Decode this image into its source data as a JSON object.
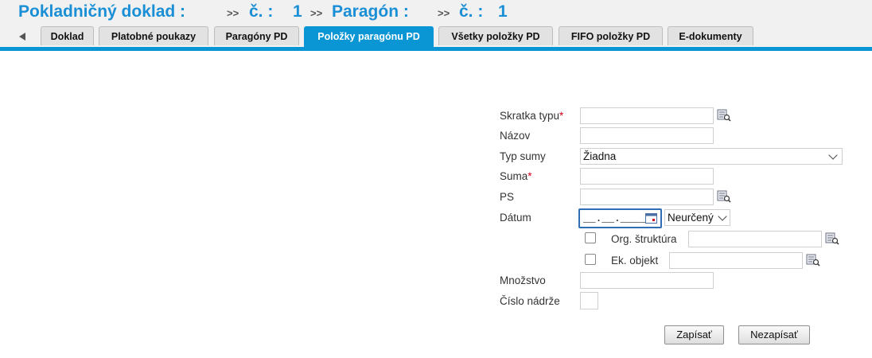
{
  "header": {
    "doc_title": "Pokladničný doklad :",
    "sep1": ">>",
    "no_label1": "č. :",
    "no_value1": "1",
    "sep2": ">>",
    "receipt_title": "Paragón :",
    "sep3": ">>",
    "no_label2": "č. :",
    "no_value2": "1"
  },
  "tabs": [
    {
      "label": "Doklad",
      "active": false
    },
    {
      "label": "Platobné poukazy",
      "active": false
    },
    {
      "label": "Paragóny PD",
      "active": false
    },
    {
      "label": "Položky paragónu PD",
      "active": true
    },
    {
      "label": "Všetky položky PD",
      "active": false
    },
    {
      "label": "FIFO položky PD",
      "active": false
    },
    {
      "label": "E-dokumenty",
      "active": false
    }
  ],
  "form": {
    "skratka_typu": {
      "label": "Skratka typu",
      "required_mark": "*",
      "value": ""
    },
    "nazov": {
      "label": "Názov",
      "value": ""
    },
    "typ_sumy": {
      "label": "Typ sumy",
      "value": "Žiadna"
    },
    "suma": {
      "label": "Suma",
      "required_mark": "*",
      "value": ""
    },
    "ps": {
      "label": "PS",
      "value": ""
    },
    "datum": {
      "label": "Dátum",
      "placeholder": "__.__.____",
      "mode_value": "Neurčený"
    },
    "org_struktura": {
      "label": "Org. štruktúra",
      "checked": false,
      "value": ""
    },
    "ek_objekt": {
      "label": "Ek. objekt",
      "checked": false,
      "value": ""
    },
    "mnozstvo": {
      "label": "Množstvo",
      "value": ""
    },
    "cislo_nadrze": {
      "label": "Číslo nádrže",
      "value": ""
    }
  },
  "buttons": {
    "save": "Zapísať",
    "cancel": "Nezapísať"
  },
  "colors": {
    "accent": "#0a95d4",
    "title": "#1a8fd6",
    "required": "#d0021b"
  }
}
